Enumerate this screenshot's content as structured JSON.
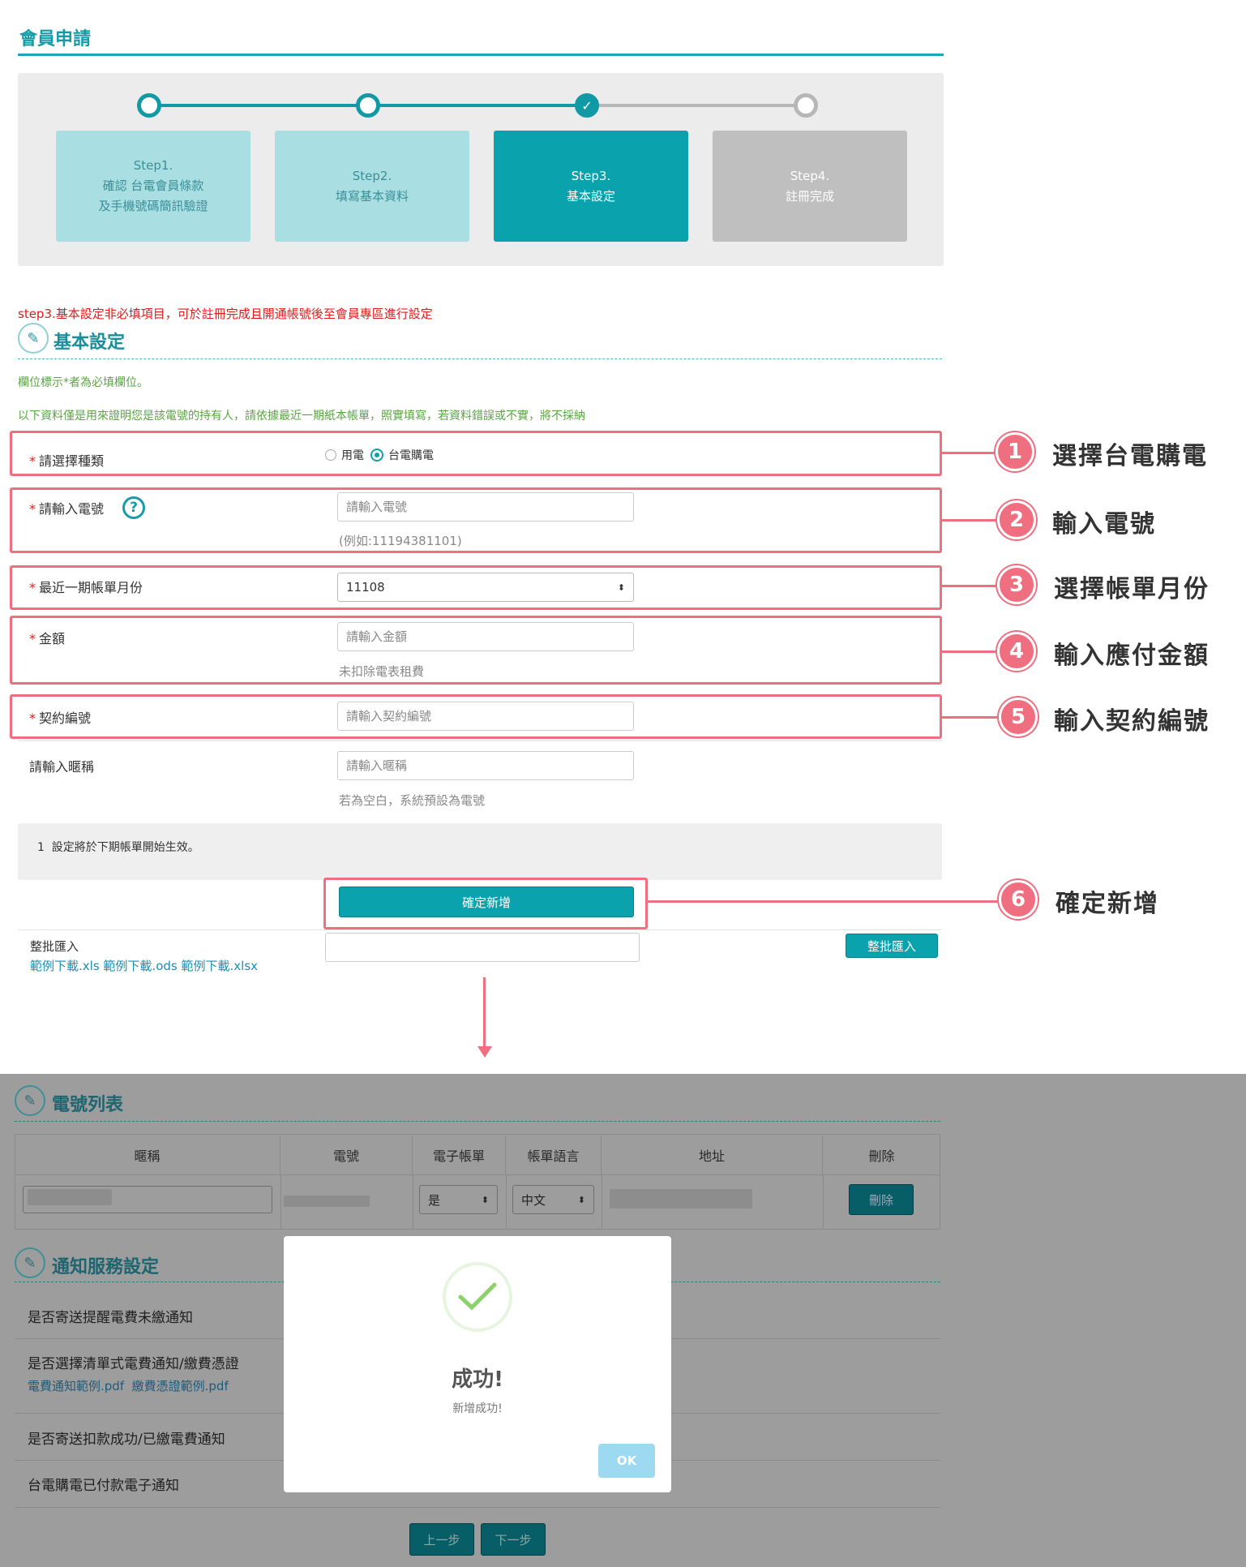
{
  "page": {
    "title": "會員申請"
  },
  "steps": [
    {
      "line1": "Step1.",
      "line2": "確認 台電會員條款",
      "line3": "及手機號碼簡訊驗證"
    },
    {
      "line1": "Step2.",
      "line2": "填寫基本資料"
    },
    {
      "line1": "Step3.",
      "line2": "基本設定"
    },
    {
      "line1": "Step4.",
      "line2": "註冊完成"
    }
  ],
  "step3_note": "step3.基本設定非必填項目，可於註冊完成且開通帳號後至會員專區進行設定",
  "section_basic": {
    "title": "基本設定",
    "required_note": "欄位標示*者為必填欄位。",
    "info": "以下資料僅是用來證明您是該電號的持有人，請依據最近一期紙本帳單，照實填寫，若資料錯誤或不實，將不採納"
  },
  "form": {
    "type": {
      "label": "請選擇種類",
      "opt1": "用電",
      "opt2": "台電購電"
    },
    "account": {
      "label": "請輸入電號",
      "placeholder": "請輸入電號",
      "hint": "(例如:11194381101)"
    },
    "month": {
      "label": "最近一期帳單月份",
      "value": "11108"
    },
    "amount": {
      "label": "金額",
      "placeholder": "請輸入金額",
      "hint": "未扣除電表租費"
    },
    "contract": {
      "label": "契約編號",
      "placeholder": "請輸入契約編號"
    },
    "nickname": {
      "label": "請輸入暱稱",
      "placeholder": "請輸入暱稱",
      "hint": "若為空白，系統預設為電號"
    },
    "effect_note": "1  設定將於下期帳單開始生效。",
    "confirm": "確定新增",
    "bulk": {
      "label": "整批匯入",
      "link1": "範例下載.xls",
      "link2": "範例下載.ods",
      "link3": "範例下載.xlsx",
      "button": "整批匯入"
    }
  },
  "callouts": [
    {
      "num": "1",
      "text": "選擇台電購電"
    },
    {
      "num": "2",
      "text": "輸入電號"
    },
    {
      "num": "3",
      "text": "選擇帳單月份"
    },
    {
      "num": "4",
      "text": "輸入應付金額"
    },
    {
      "num": "5",
      "text": "輸入契約編號"
    },
    {
      "num": "6",
      "text": "確定新增"
    }
  ],
  "account_list": {
    "title": "電號列表",
    "headers": [
      "暱稱",
      "電號",
      "電子帳單",
      "帳單語言",
      "地址",
      "刪除"
    ],
    "ebill": "是",
    "lang": "中文",
    "delete": "刪除"
  },
  "notify": {
    "title": "通知服務設定",
    "rows": [
      "是否寄送提醒電費未繳通知",
      "是否選擇清單式電費通知/繳費憑證",
      "是否寄送扣款成功/已繳電費通知",
      "台電購電已付款電子通知"
    ],
    "link1": "電費通知範例.pdf",
    "link2": "繳費憑證範例.pdf"
  },
  "nav": {
    "prev": "上一步",
    "next": "下一步"
  },
  "modal": {
    "title": "成功!",
    "message": "新增成功!",
    "ok": "OK"
  },
  "colors": {
    "teal": "#0aa3ad",
    "callout": "#ef6f80",
    "required": "#e01b1b"
  }
}
